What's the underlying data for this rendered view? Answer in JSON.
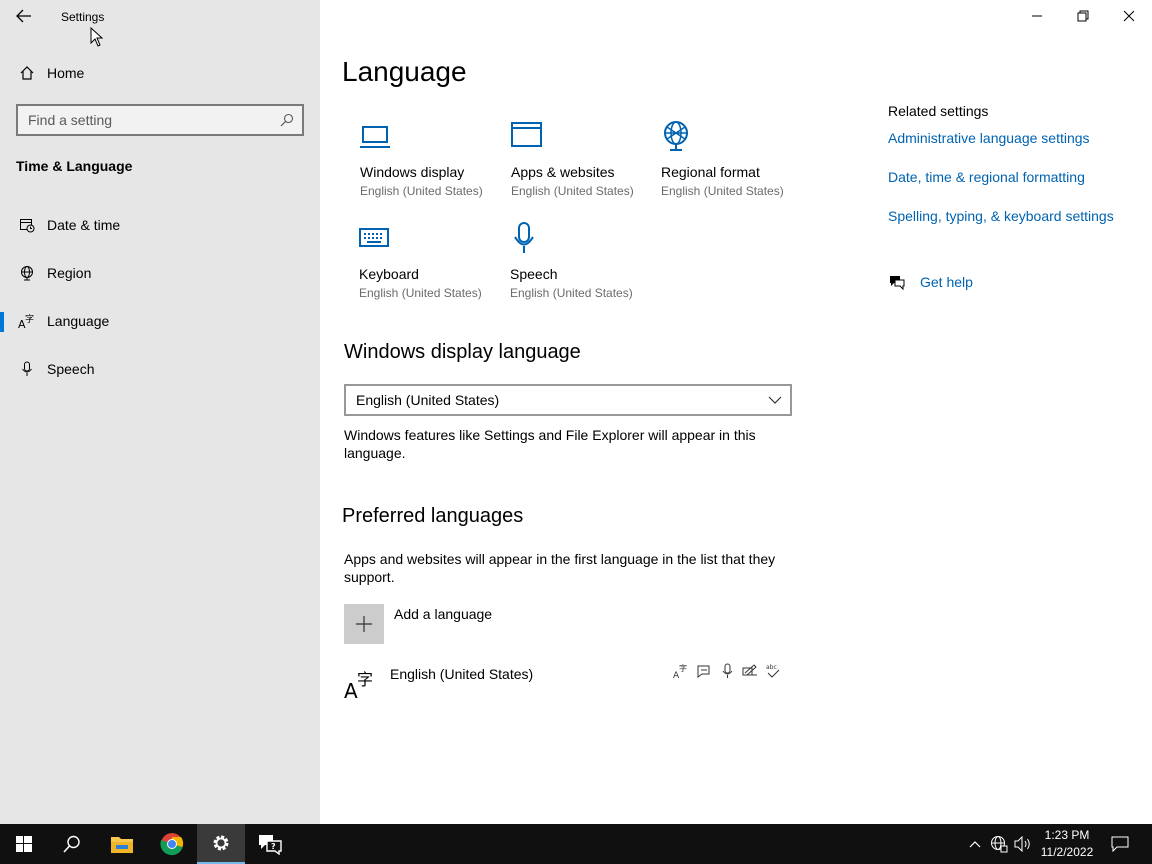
{
  "window": {
    "title": "Settings",
    "controls": {
      "minimize": "—",
      "restore": "❐",
      "close": "✕"
    }
  },
  "sidebar": {
    "home_label": "Home",
    "search_placeholder": "Find a setting",
    "section_title": "Time & Language",
    "items": [
      {
        "label": "Date & time",
        "icon": "calendar-clock-icon"
      },
      {
        "label": "Region",
        "icon": "globe-icon"
      },
      {
        "label": "Language",
        "icon": "language-icon",
        "active": true
      },
      {
        "label": "Speech",
        "icon": "microphone-icon"
      }
    ]
  },
  "main": {
    "title": "Language",
    "tiles": [
      {
        "label": "Windows display",
        "sub": "English (United States)",
        "icon": "monitor-icon"
      },
      {
        "label": "Apps & websites",
        "sub": "English (United States)",
        "icon": "browser-window-icon"
      },
      {
        "label": "Regional format",
        "sub": "English (United States)",
        "icon": "globe-icon"
      },
      {
        "label": "Keyboard",
        "sub": "English (United States)",
        "icon": "keyboard-icon"
      },
      {
        "label": "Speech",
        "sub": "English (United States)",
        "icon": "microphone-icon"
      }
    ],
    "display_language": {
      "heading": "Windows display language",
      "selected": "English (United States)",
      "description": "Windows features like Settings and File Explorer will appear in this language."
    },
    "preferred": {
      "heading": "Preferred languages",
      "description": "Apps and websites will appear in the first language in the list that they support.",
      "add_label": "Add a language",
      "languages": [
        {
          "name": "English (United States)",
          "features": [
            "display-language-icon",
            "text-to-speech-icon",
            "speech-recognition-icon",
            "handwriting-icon",
            "spell-check-icon"
          ]
        }
      ]
    }
  },
  "related": {
    "title": "Related settings",
    "links": [
      "Administrative language settings",
      "Date, time & regional formatting",
      "Spelling, typing, & keyboard settings"
    ],
    "help_label": "Get help"
  },
  "taskbar": {
    "time": "1:23 PM",
    "date": "11/2/2022",
    "accent": "#76b9ed"
  },
  "colors": {
    "accent": "#0078d7",
    "link": "#0063b1",
    "sidebar_bg": "#e6e6e6"
  }
}
